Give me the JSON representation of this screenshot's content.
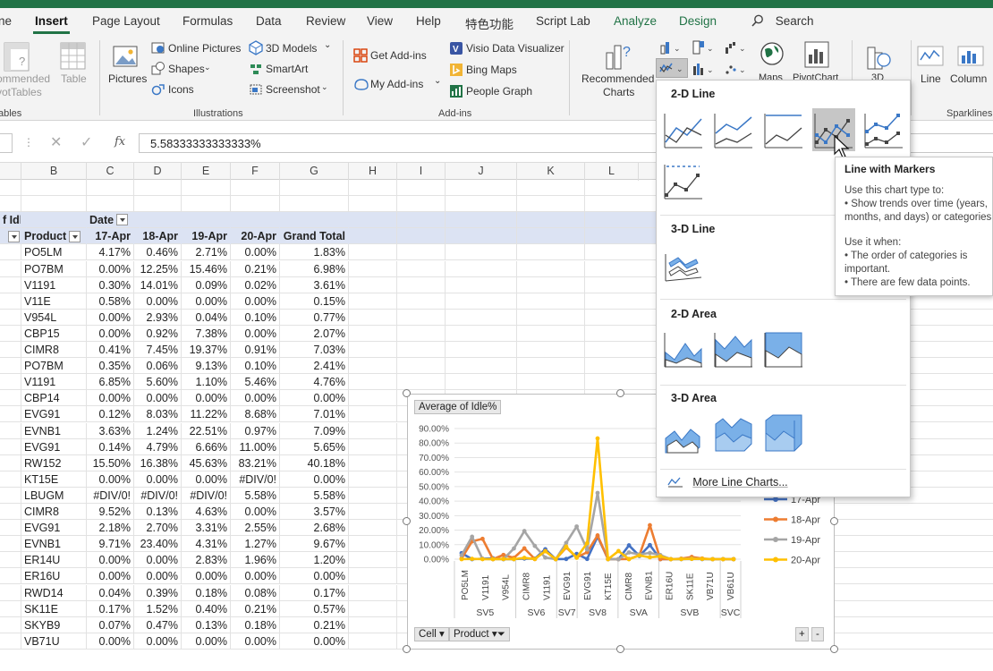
{
  "ribbon_tabs": {
    "file": "ne",
    "insert": "Insert",
    "page_layout": "Page Layout",
    "formulas": "Formulas",
    "data": "Data",
    "review": "Review",
    "view": "View",
    "help": "Help",
    "special": "特色功能",
    "script_lab": "Script Lab",
    "analyze": "Analyze",
    "design": "Design",
    "search": "Search"
  },
  "ribbon": {
    "tables": {
      "recommended": "ommended",
      "pivot": "votTables",
      "table": "Table",
      "group": "ables"
    },
    "illustrations": {
      "pictures": "Pictures",
      "online_pictures": "Online Pictures",
      "shapes": "Shapes",
      "icons": "Icons",
      "models_3d": "3D Models",
      "smartart": "SmartArt",
      "screenshot": "Screenshot",
      "group": "Illustrations"
    },
    "addins": {
      "get_addins": "Get Add-ins",
      "my_addins": "My Add-ins",
      "visio": "Visio Data Visualizer",
      "bing_maps": "Bing Maps",
      "people_graph": "People Graph",
      "group": "Add-ins"
    },
    "charts": {
      "recommended_1": "Recommended",
      "recommended_2": "Charts",
      "maps": "Maps",
      "pivotchart": "PivotChart",
      "map3d": "3D"
    },
    "sparklines": {
      "line": "Line",
      "column": "Column",
      "group": "Sparklines"
    }
  },
  "formula_bar": {
    "value": "5.58333333333333%"
  },
  "columns": [
    "B",
    "C",
    "D",
    "E",
    "F",
    "G",
    "H",
    "I",
    "J",
    "K",
    "L"
  ],
  "pivot": {
    "top_left": "f Idl",
    "date_label": "Date",
    "header": [
      "Product",
      "17-Apr",
      "18-Apr",
      "19-Apr",
      "20-Apr",
      "Grand Total"
    ],
    "rows": [
      [
        "PO5LM",
        "4.17%",
        "0.46%",
        "2.71%",
        "0.00%",
        "1.83%"
      ],
      [
        "PO7BM",
        "0.00%",
        "12.25%",
        "15.46%",
        "0.21%",
        "6.98%"
      ],
      [
        "V1191",
        "0.30%",
        "14.01%",
        "0.09%",
        "0.02%",
        "3.61%"
      ],
      [
        "V11E",
        "0.58%",
        "0.00%",
        "0.00%",
        "0.00%",
        "0.15%"
      ],
      [
        "V954L",
        "0.00%",
        "2.93%",
        "0.04%",
        "0.10%",
        "0.77%"
      ],
      [
        "CBP15",
        "0.00%",
        "0.92%",
        "7.38%",
        "0.00%",
        "2.07%"
      ],
      [
        "CIMR8",
        "0.41%",
        "7.45%",
        "19.37%",
        "0.91%",
        "7.03%"
      ],
      [
        "PO7BM",
        "0.35%",
        "0.06%",
        "9.13%",
        "0.10%",
        "2.41%"
      ],
      [
        "V1191",
        "6.85%",
        "5.60%",
        "1.10%",
        "5.46%",
        "4.76%"
      ],
      [
        "CBP14",
        "0.00%",
        "0.00%",
        "0.00%",
        "0.00%",
        "0.00%"
      ],
      [
        "EVG91",
        "0.12%",
        "8.03%",
        "11.22%",
        "8.68%",
        "7.01%"
      ],
      [
        "EVNB1",
        "3.63%",
        "1.24%",
        "22.51%",
        "0.97%",
        "7.09%"
      ],
      [
        "EVG91",
        "0.14%",
        "4.79%",
        "6.66%",
        "11.00%",
        "5.65%"
      ],
      [
        "RW152",
        "15.50%",
        "16.38%",
        "45.63%",
        "83.21%",
        "40.18%"
      ],
      [
        "KT15E",
        "0.00%",
        "0.00%",
        "0.00%",
        "#DIV/0!",
        "0.00%"
      ],
      [
        "LBUGM",
        "#DIV/0!",
        "#DIV/0!",
        "#DIV/0!",
        "5.58%",
        "5.58%"
      ],
      [
        "CIMR8",
        "9.52%",
        "0.13%",
        "4.63%",
        "0.00%",
        "3.57%"
      ],
      [
        "EVG91",
        "2.18%",
        "2.70%",
        "3.31%",
        "2.55%",
        "2.68%"
      ],
      [
        "EVNB1",
        "9.71%",
        "23.40%",
        "4.31%",
        "1.27%",
        "9.67%"
      ],
      [
        "ER14U",
        "0.00%",
        "0.00%",
        "2.83%",
        "1.96%",
        "1.20%"
      ],
      [
        "ER16U",
        "0.00%",
        "0.00%",
        "0.00%",
        "0.00%",
        "0.00%"
      ],
      [
        "RWD14",
        "0.04%",
        "0.39%",
        "0.18%",
        "0.08%",
        "0.17%"
      ],
      [
        "SK11E",
        "0.17%",
        "1.52%",
        "0.40%",
        "0.21%",
        "0.57%"
      ],
      [
        "SKYB9",
        "0.07%",
        "0.47%",
        "0.13%",
        "0.18%",
        "0.21%"
      ],
      [
        "VB71U",
        "0.00%",
        "0.00%",
        "0.00%",
        "0.00%",
        "0.00%"
      ]
    ]
  },
  "chart_data": {
    "type": "line",
    "title": "Average of Idle%",
    "y_ticks": [
      "0.00%",
      "10.00%",
      "20.00%",
      "30.00%",
      "40.00%",
      "50.00%",
      "60.00%",
      "70.00%",
      "80.00%",
      "90.00%"
    ],
    "ylim": [
      0,
      90
    ],
    "categories": [
      "PO5LM",
      "V1191",
      "V954L",
      "CIMR8",
      "V1191",
      "EVG91",
      "EVG91",
      "KT15E",
      "CIMR8",
      "EVNB1",
      "ER16U",
      "SK11E",
      "VB71U",
      "VB61U"
    ],
    "groups": [
      {
        "name": "SV5",
        "from": 0,
        "to": 2
      },
      {
        "name": "SV6",
        "from": 3,
        "to": 4
      },
      {
        "name": "SV7",
        "from": 5,
        "to": 5
      },
      {
        "name": "SV8",
        "from": 6,
        "to": 7
      },
      {
        "name": "SVA",
        "from": 8,
        "to": 9
      },
      {
        "name": "SVB",
        "from": 10,
        "to": 12
      },
      {
        "name": "SVC",
        "from": 13,
        "to": 13
      }
    ],
    "n_points": 27,
    "series": [
      {
        "name": "17-Apr",
        "color": "#4472c4",
        "values": [
          4.17,
          0,
          0.3,
          0.58,
          0,
          0,
          0.41,
          0.35,
          6.85,
          0,
          0.12,
          3.63,
          0.14,
          15.5,
          0,
          0,
          9.52,
          2.18,
          9.71,
          0,
          0,
          0.04,
          0.17,
          0.07,
          0,
          0,
          0
        ]
      },
      {
        "name": "18-Apr",
        "color": "#ed7d31",
        "values": [
          0.46,
          12.25,
          14.01,
          0,
          2.93,
          0.92,
          7.45,
          0.06,
          5.6,
          0,
          8.03,
          1.24,
          4.79,
          16.38,
          0,
          0,
          0.13,
          2.7,
          23.4,
          0,
          0,
          0.39,
          1.52,
          0.47,
          0,
          0,
          0
        ]
      },
      {
        "name": "19-Apr",
        "color": "#a5a5a5",
        "values": [
          2.71,
          15.46,
          0.09,
          0,
          0.04,
          7.38,
          19.37,
          9.13,
          1.1,
          0,
          11.22,
          22.51,
          6.66,
          45.63,
          0,
          0,
          4.63,
          3.31,
          4.31,
          2.83,
          0,
          0.18,
          0.4,
          0.13,
          0,
          0,
          0
        ]
      },
      {
        "name": "20-Apr",
        "color": "#ffc000",
        "values": [
          0,
          0.21,
          0.02,
          0,
          0.1,
          0,
          0.91,
          0.1,
          5.46,
          0,
          8.68,
          0.97,
          11.0,
          83.21,
          0,
          5.58,
          0,
          2.55,
          1.27,
          1.96,
          0,
          0.08,
          0.21,
          0.18,
          0,
          0,
          0
        ]
      }
    ],
    "legend": "right",
    "legend_visible": [
      "17-Apr",
      "18-Apr",
      "19-Apr",
      "20-Apr"
    ],
    "field_buttons": {
      "cell": "Cell",
      "product": "Product"
    }
  },
  "gallery": {
    "line_2d": "2-D Line",
    "line_3d": "3-D Line",
    "area_2d": "2-D Area",
    "area_3d": "3-D Area",
    "more": "More Line Charts..."
  },
  "tooltip": {
    "title": "Line with Markers",
    "lines": [
      "Use this chart type to:",
      "• Show trends over time (years,",
      "months, and days) or categories",
      "",
      "Use it when:",
      "• The order of categories is",
      "important.",
      "• There are few data points."
    ]
  }
}
